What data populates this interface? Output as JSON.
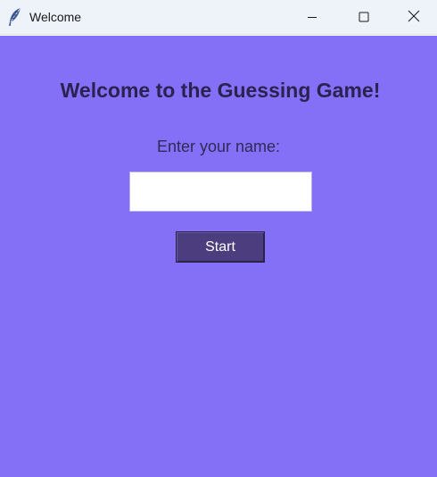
{
  "window": {
    "title": "Welcome",
    "icon": "feather-icon",
    "controls": [
      "minimize-icon",
      "maximize-icon",
      "close-icon"
    ]
  },
  "main": {
    "heading": "Welcome to the Guessing Game!",
    "prompt": "Enter your name:",
    "name_input": {
      "value": "",
      "placeholder": ""
    },
    "start_label": "Start"
  },
  "colors": {
    "background": "#8470f7",
    "title_bar": "#eef2f9",
    "heading_text": "#2b2250",
    "button_bg": "#4c3e7e",
    "button_text": "#ffffff"
  }
}
